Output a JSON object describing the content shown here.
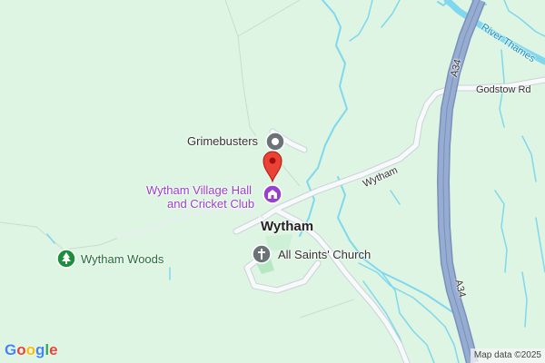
{
  "map": {
    "places": {
      "village": "Wytham",
      "woods": "Wytham Woods",
      "church": "All Saints' Church",
      "business": "Grimebusters",
      "hall_line1": "Wytham Village Hall",
      "hall_line2": "and Cricket Club"
    },
    "roads": {
      "a34_top": "A34",
      "a34_bottom": "A34",
      "wytham_road": "Wytham",
      "godstow": "Godstow Rd"
    },
    "water": {
      "river": "River Thames"
    },
    "icons": {
      "pin": "map-pin",
      "grimebusters": "business-pin-icon",
      "hall": "community-hall-icon",
      "church": "church-cross-icon",
      "woods": "tree-icon"
    },
    "colors": {
      "land": "#ddf5e2",
      "water": "#7fd8ee",
      "motorway": "#8ea3c9",
      "road": "#f8f9fa",
      "pin": "#ea4335",
      "poi_purple": "#9b3fd1",
      "poi_gray": "#6b7379",
      "park_green": "#1e8e3e"
    },
    "branding": {
      "logo_letters": [
        "G",
        "o",
        "o",
        "g",
        "l",
        "e"
      ],
      "attribution": "Map data ©2025"
    }
  }
}
